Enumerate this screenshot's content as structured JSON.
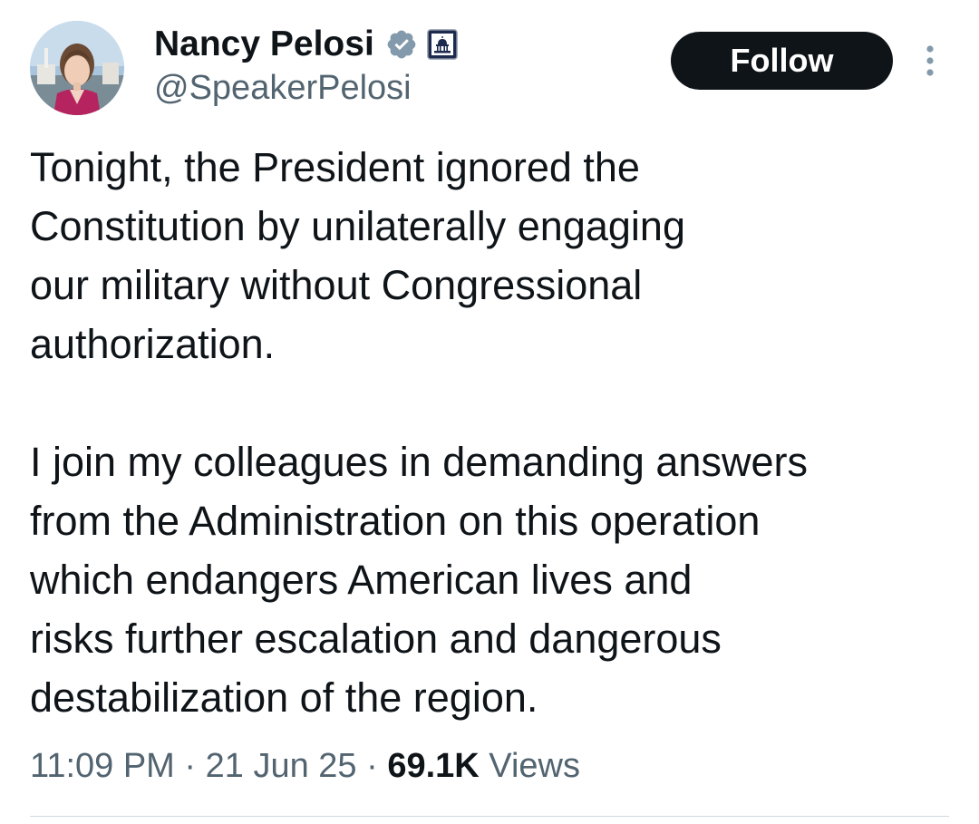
{
  "tweet": {
    "author": {
      "display_name": "Nancy Pelosi",
      "handle": "@SpeakerPelosi",
      "verified_badge_icon": "gray-verified-checkmark-icon",
      "affiliation_badge_icon": "us-capitol-badge-icon",
      "badge_color": "#829aab"
    },
    "follow_label": "Follow",
    "more_icon": "vertical-ellipsis-icon",
    "paragraphs": [
      "Tonight, the President ignored the\nConstitution by unilaterally engaging\nour military without Congressional\nauthorization.",
      "I join my colleagues in demanding answers\nfrom the Administration on this operation\nwhich endangers American lives and\nrisks further escalation and dangerous\ndestabilization of the region."
    ],
    "time": "11:09 PM",
    "separator": "·",
    "date": "21 Jun 25",
    "views_count": "69.1K",
    "views_label": "Views"
  },
  "colors": {
    "text_primary": "#0f1419",
    "text_secondary": "#536471",
    "button_bg": "#0f1419",
    "divider": "#cfd9de"
  }
}
